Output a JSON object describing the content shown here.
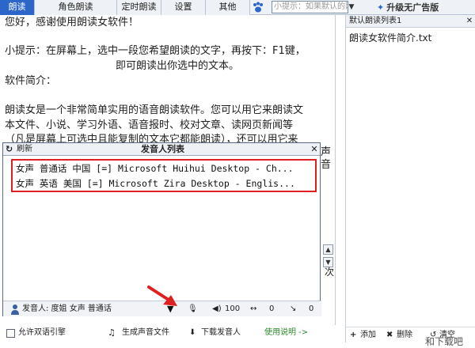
{
  "toolbar": {
    "tabs": [
      "朗读",
      "角色朗读",
      "定时朗读",
      "设置",
      "其他"
    ],
    "tip_placeholder": "小提示：如果默认的网",
    "upgrade_label": "升级无广告版"
  },
  "editor": {
    "lines": [
      "您好，感谢使用朗读女软件！",
      "小提示：在屏幕上，选中一段您希望朗读的文字，再按下：F1键，",
      "即可朗读出你选中的文本。",
      "软件简介：",
      "朗读女是一个非常简单实用的语音朗读软件。您可以用它来朗读文",
      "本文件、小说、学习外语、语音报时、校对文章、读网页新闻等",
      "（凡是屏幕上可选中且能复制的文本它都能朗读），还可以用它来"
    ],
    "partial_glyphs": [
      "帮",
      "音",
      "声"
    ],
    "next_glyph": "次"
  },
  "popup": {
    "refresh_label": "刷新",
    "caption": "发音人列表",
    "voices": [
      "女声 普通话 中国 [=] Microsoft Huihui Desktop - Ch...",
      "女声 英语 美国 [=] Microsoft Zira Desktop - Englis..."
    ]
  },
  "voice_bar": {
    "speaker_label": "发音人: 度姐 女声 普通话",
    "volume": "100",
    "speed": "0",
    "pitch": "0"
  },
  "bottom_bar": {
    "bilingual_label": "允许双语引擎",
    "generate_label": "生成声音文件",
    "download_label": "下载发音人",
    "help_label": "使用说明 ->"
  },
  "right_panel": {
    "list_name": "默认朗读列表1",
    "file_item": "朗读女软件简介.txt",
    "add_label": "添加",
    "delete_label": "删除",
    "clear_label": "清空"
  },
  "watermark": "和下载吧",
  "colors": {
    "accent": "#2b66c8",
    "highlight_border": "#e02020",
    "help_link": "#2b8a2b"
  }
}
